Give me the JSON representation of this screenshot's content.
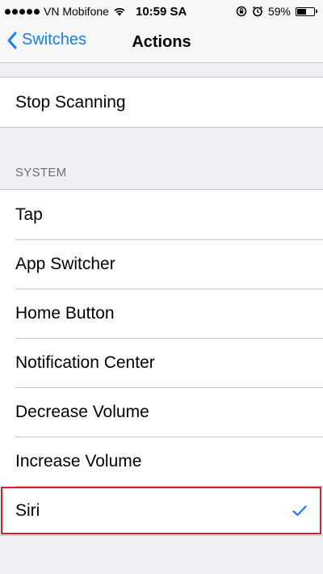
{
  "status_bar": {
    "carrier": "VN Mobifone",
    "time": "10:59 SA",
    "battery_percent": "59%",
    "battery_level": 0.59,
    "signal_bars": 5
  },
  "nav": {
    "back_label": "Switches",
    "title": "Actions"
  },
  "top_group": {
    "rows": [
      {
        "label": "Stop Scanning"
      }
    ]
  },
  "system_section": {
    "header": "SYSTEM",
    "rows": [
      {
        "label": "Tap",
        "checked": false
      },
      {
        "label": "App Switcher",
        "checked": false
      },
      {
        "label": "Home Button",
        "checked": false
      },
      {
        "label": "Notification Center",
        "checked": false
      },
      {
        "label": "Decrease Volume",
        "checked": false
      },
      {
        "label": "Increase Volume",
        "checked": false
      },
      {
        "label": "Siri",
        "checked": true
      }
    ]
  },
  "colors": {
    "accent": "#1a7cf6",
    "highlight": "#d8202a",
    "background": "#efeff4"
  }
}
